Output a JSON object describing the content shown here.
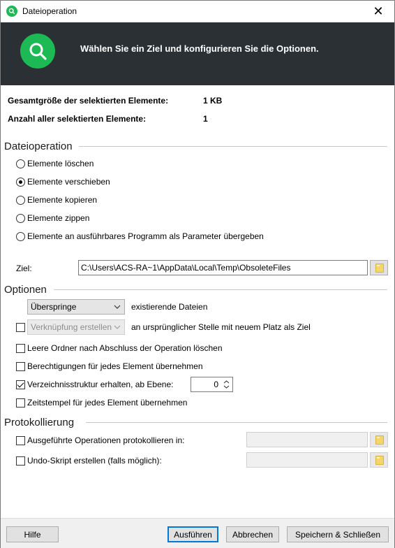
{
  "window": {
    "title": "Dateioperation",
    "close_glyph": "✕"
  },
  "banner": {
    "text": "Wählen Sie ein Ziel und konfigurieren Sie die Optionen.",
    "accent": "#1db954",
    "background": "#2b3034"
  },
  "info": {
    "total_size_label": "Gesamtgröße der selektierten Elemente:",
    "total_size_value": "1 KB",
    "count_label": "Anzahl aller selektierten Elemente:",
    "count_value": "1"
  },
  "operation": {
    "heading": "Dateioperation",
    "options": [
      {
        "label": "Elemente löschen",
        "selected": false
      },
      {
        "label": "Elemente verschieben",
        "selected": true
      },
      {
        "label": "Elemente kopieren",
        "selected": false
      },
      {
        "label": "Elemente zippen",
        "selected": false
      },
      {
        "label": "Elemente an ausführbares Programm als Parameter übergeben",
        "selected": false
      }
    ],
    "target_label": "Ziel:",
    "target_value": "C:\\Users\\ACS-RA~1\\AppData\\Local\\Temp\\ObsoleteFiles"
  },
  "options": {
    "heading": "Optionen",
    "existing_select": "Überspringe",
    "existing_label": "existierende Dateien",
    "link_checked": false,
    "link_select": "Verknüpfung erstellen",
    "link_label": "an ursprünglicher Stelle mit neuem Platz als Ziel",
    "empty_folders": {
      "label": "Leere Ordner nach Abschluss der Operation löschen",
      "checked": false
    },
    "permissions": {
      "label": "Berechtigungen für jedes Element übernehmen",
      "checked": false
    },
    "keep_structure": {
      "label": "Verzeichnisstruktur erhalten, ab Ebene:",
      "checked": true,
      "level": "0"
    },
    "timestamps": {
      "label": "Zeitstempel für jedes Element übernehmen",
      "checked": false
    }
  },
  "logging": {
    "heading": "Protokollierung",
    "log_ops": {
      "label": "Ausgeführte Operationen protokollieren in:",
      "checked": false,
      "value": ""
    },
    "undo_script": {
      "label": "Undo-Skript erstellen (falls möglich):",
      "checked": false,
      "value": ""
    }
  },
  "footer": {
    "help": "Hilfe",
    "run": "Ausführen",
    "cancel": "Abbrechen",
    "save_close": "Speichern & Schließen"
  }
}
